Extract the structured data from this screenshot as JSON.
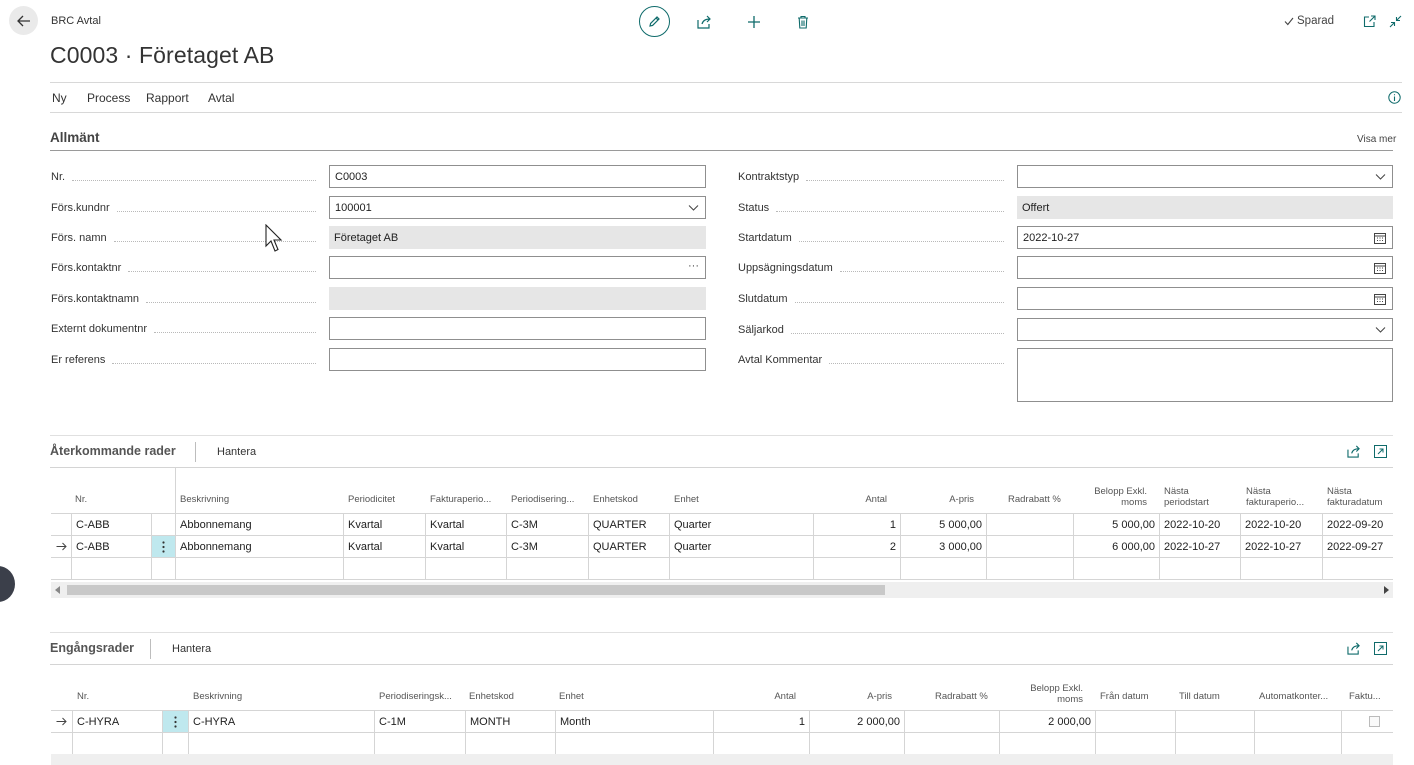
{
  "header": {
    "breadcrumb": "BRC Avtal",
    "title": "C0003 · Företaget AB",
    "saved_label": "Sparad"
  },
  "actions": [
    "Ny",
    "Process",
    "Rapport",
    "Avtal"
  ],
  "general": {
    "section_title": "Allmänt",
    "show_more": "Visa mer",
    "left_fields": [
      {
        "label": "Nr.",
        "value": "C0003"
      },
      {
        "label": "Förs.kundnr",
        "value": "100001"
      },
      {
        "label": "Förs. namn",
        "value": "Företaget AB"
      },
      {
        "label": "Förs.kontaktnr",
        "value": ""
      },
      {
        "label": "Förs.kontaktnamn",
        "value": ""
      },
      {
        "label": "Externt dokumentnr",
        "value": ""
      },
      {
        "label": "Er referens",
        "value": ""
      }
    ],
    "right_fields": [
      {
        "label": "Kontraktstyp",
        "value": ""
      },
      {
        "label": "Status",
        "value": "Offert"
      },
      {
        "label": "Startdatum",
        "value": "2022-10-27"
      },
      {
        "label": "Uppsägningsdatum",
        "value": ""
      },
      {
        "label": "Slutdatum",
        "value": ""
      },
      {
        "label": "Säljarkod",
        "value": ""
      },
      {
        "label": "Avtal Kommentar",
        "value": ""
      }
    ]
  },
  "recurring": {
    "title": "Återkommande rader",
    "manage": "Hantera",
    "headers": {
      "nr": "Nr.",
      "desc": "Beskrivning",
      "period": "Periodicitet",
      "invperiod": "Fakturaperio...",
      "accrual": "Periodisering...",
      "unitcode": "Enhetskod",
      "unit": "Enhet",
      "qty": "Antal",
      "price": "A-pris",
      "discount": "Radrabatt %",
      "amount1": "Belopp Exkl.",
      "amount2": "moms",
      "nextps1": "Nästa",
      "nextps2": "periodstart",
      "nextip1": "Nästa",
      "nextip2": "fakturaperio...",
      "nextid1": "Nästa",
      "nextid2": "fakturadatum"
    },
    "rows": [
      {
        "nr": "C-ABB",
        "desc": "Abbonnemang",
        "period": "Kvartal",
        "invperiod": "Kvartal",
        "accrual": "C-3M",
        "unitcode": "QUARTER",
        "unit": "Quarter",
        "qty": "1",
        "price": "5 000,00",
        "discount": "",
        "amount": "5 000,00",
        "nextps": "2022-10-20",
        "nextip": "2022-10-20",
        "nextid": "2022-09-20"
      },
      {
        "nr": "C-ABB",
        "desc": "Abbonnemang",
        "period": "Kvartal",
        "invperiod": "Kvartal",
        "accrual": "C-3M",
        "unitcode": "QUARTER",
        "unit": "Quarter",
        "qty": "2",
        "price": "3 000,00",
        "discount": "",
        "amount": "6 000,00",
        "nextps": "2022-10-27",
        "nextip": "2022-10-27",
        "nextid": "2022-09-27"
      }
    ]
  },
  "onetime": {
    "title": "Engångsrader",
    "manage": "Hantera",
    "headers": {
      "nr": "Nr.",
      "desc": "Beskrivning",
      "accrual": "Periodiseringsk...",
      "unitcode": "Enhetskod",
      "unit": "Enhet",
      "qty": "Antal",
      "price": "A-pris",
      "discount": "Radrabatt %",
      "amount1": "Belopp Exkl.",
      "amount2": "moms",
      "from": "Från datum",
      "to": "Till datum",
      "autoacc": "Automatkonter...",
      "inv": "Faktu..."
    },
    "rows": [
      {
        "nr": "C-HYRA",
        "desc": "C-HYRA",
        "accrual": "C-1M",
        "unitcode": "MONTH",
        "unit": "Month",
        "qty": "1",
        "price": "2 000,00",
        "discount": "",
        "amount": "2 000,00",
        "from": "",
        "to": "",
        "autoacc": "",
        "inv": false
      }
    ]
  },
  "colors": {
    "accent": "#0f6b6b",
    "row_menu": "#bfe8ee",
    "readonly_field": "#e6e6e6"
  }
}
